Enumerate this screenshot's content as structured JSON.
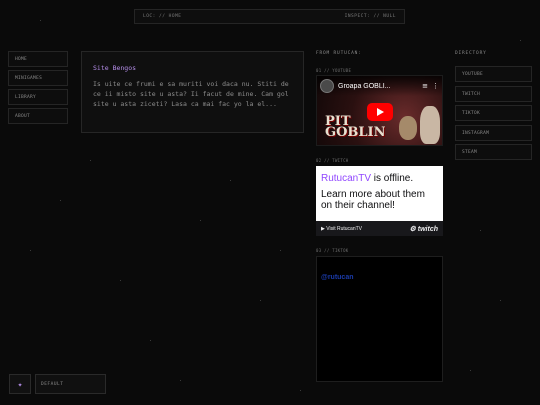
{
  "topbar": {
    "loc": "LOC: // HOME",
    "inspect": "INSPECT: // NULL"
  },
  "nav": {
    "items": [
      {
        "label": "HOME"
      },
      {
        "label": "MINIGAMES"
      },
      {
        "label": "LIBRARY"
      },
      {
        "label": "ABOUT"
      }
    ]
  },
  "card": {
    "title": "Site Bengos",
    "body": "Is uite ce frumi e sa muriti voi daca nu. Stiti de ce ii misto site u asta? Ii facut de mine. Cam gol site u asta ziceti? Lasa ca mai fac yo la el..."
  },
  "feed": {
    "heading": "FROM RUTUCAN:",
    "youtube": {
      "label": "01 // YOUTUBE",
      "video_title": "Groapa GOBLI...",
      "thumb_text_1": "PIT",
      "thumb_text_2": "GOBLIN"
    },
    "twitch": {
      "label": "02 // TWITCH",
      "channel": "RutucanTV",
      "offline_text": " is offline.",
      "more_text": "Learn more about them on their channel!",
      "bar_text": "▶ Visit RutucanTV",
      "brand": "twitch"
    },
    "tiktok": {
      "label": "03 // TIKTOK",
      "link": "@rutucan"
    }
  },
  "directory": {
    "heading": "DIRECTORY",
    "items": [
      {
        "label": "YOUTUBE"
      },
      {
        "label": "TWITCH"
      },
      {
        "label": "TIKTOK"
      },
      {
        "label": "INSTAGRAM"
      },
      {
        "label": "STEAM"
      }
    ]
  },
  "theme": {
    "label": "DEFAULT",
    "icon": "sparkle-icon"
  }
}
